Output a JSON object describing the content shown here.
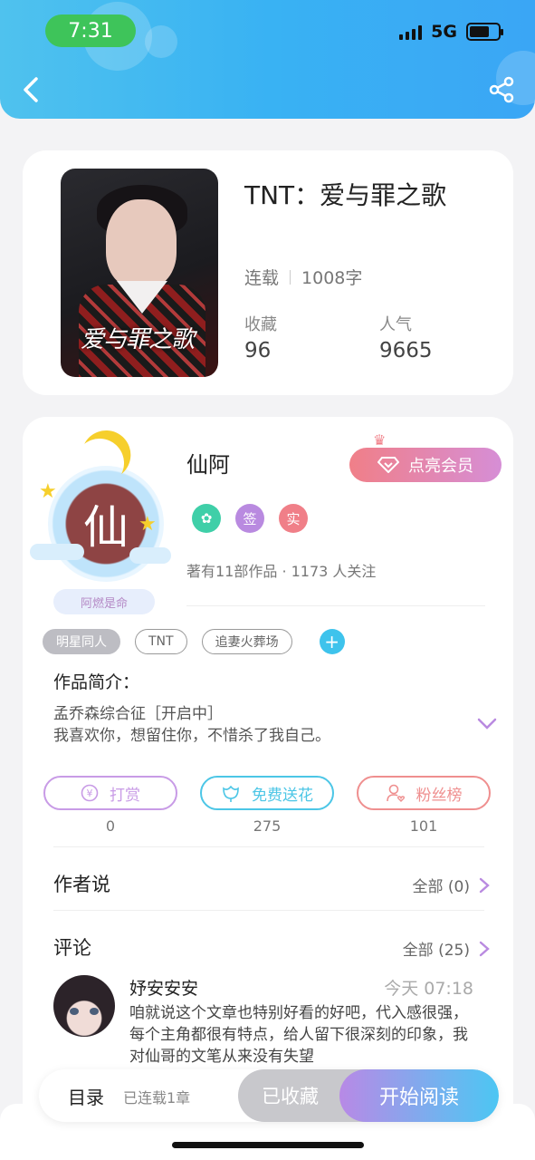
{
  "status_bar": {
    "time": "7:31",
    "network": "5G"
  },
  "header": {
    "back_icon": "chevron-left-icon",
    "share_icon": "share-icon"
  },
  "book": {
    "cover_title": "爱与罪之歌",
    "title": "TNT：爱与罪之歌",
    "status": "连载",
    "word_count": "1008字",
    "favorites_label": "收藏",
    "favorites_value": "96",
    "popularity_label": "人气",
    "popularity_value": "9665"
  },
  "author": {
    "avatar_char": "仙",
    "nickname_badge": "阿燃是命",
    "name": "仙阿",
    "vip_button": "点亮会员",
    "badges": [
      {
        "icon": "flower-badge-icon",
        "text": "",
        "color": "#3fcfa8"
      },
      {
        "icon": "sign-badge-icon",
        "text": "签",
        "color": "#b98ae0"
      },
      {
        "icon": "real-badge-icon",
        "text": "实",
        "color": "#f07f88"
      }
    ],
    "info": "著有11部作品 · 1173 人关注"
  },
  "tags": [
    "明星同人",
    "TNT",
    "追妻火葬场"
  ],
  "intro": {
    "title": "作品简介：",
    "text": "孟乔森综合征［开启中］\n我喜欢你，想留住你，不惜杀了我自己。"
  },
  "actions": [
    {
      "label": "打赏",
      "count": "0",
      "icon": "yen-icon",
      "color": "#c89be6"
    },
    {
      "label": "免费送花",
      "count": "275",
      "icon": "flower-icon",
      "color": "#4cc6e6"
    },
    {
      "label": "粉丝榜",
      "count": "101",
      "icon": "fans-icon",
      "color": "#ef8f8f"
    }
  ],
  "author_says": {
    "title": "作者说",
    "link": "全部 (0)"
  },
  "comments": {
    "title": "评论",
    "link": "全部 (25)",
    "items": [
      {
        "user": "妤安安安",
        "time": "今天 07:18",
        "text": "咱就说这个文章也特别好看的好吧，代入感很强，每个主角都很有特点，给人留下很深刻的印象，我对仙哥的文笔从来没有失望"
      }
    ]
  },
  "bottom_bar": {
    "toc": "目录",
    "toc_status": "已连载1章",
    "collected": "已收藏",
    "read": "开始阅读"
  }
}
